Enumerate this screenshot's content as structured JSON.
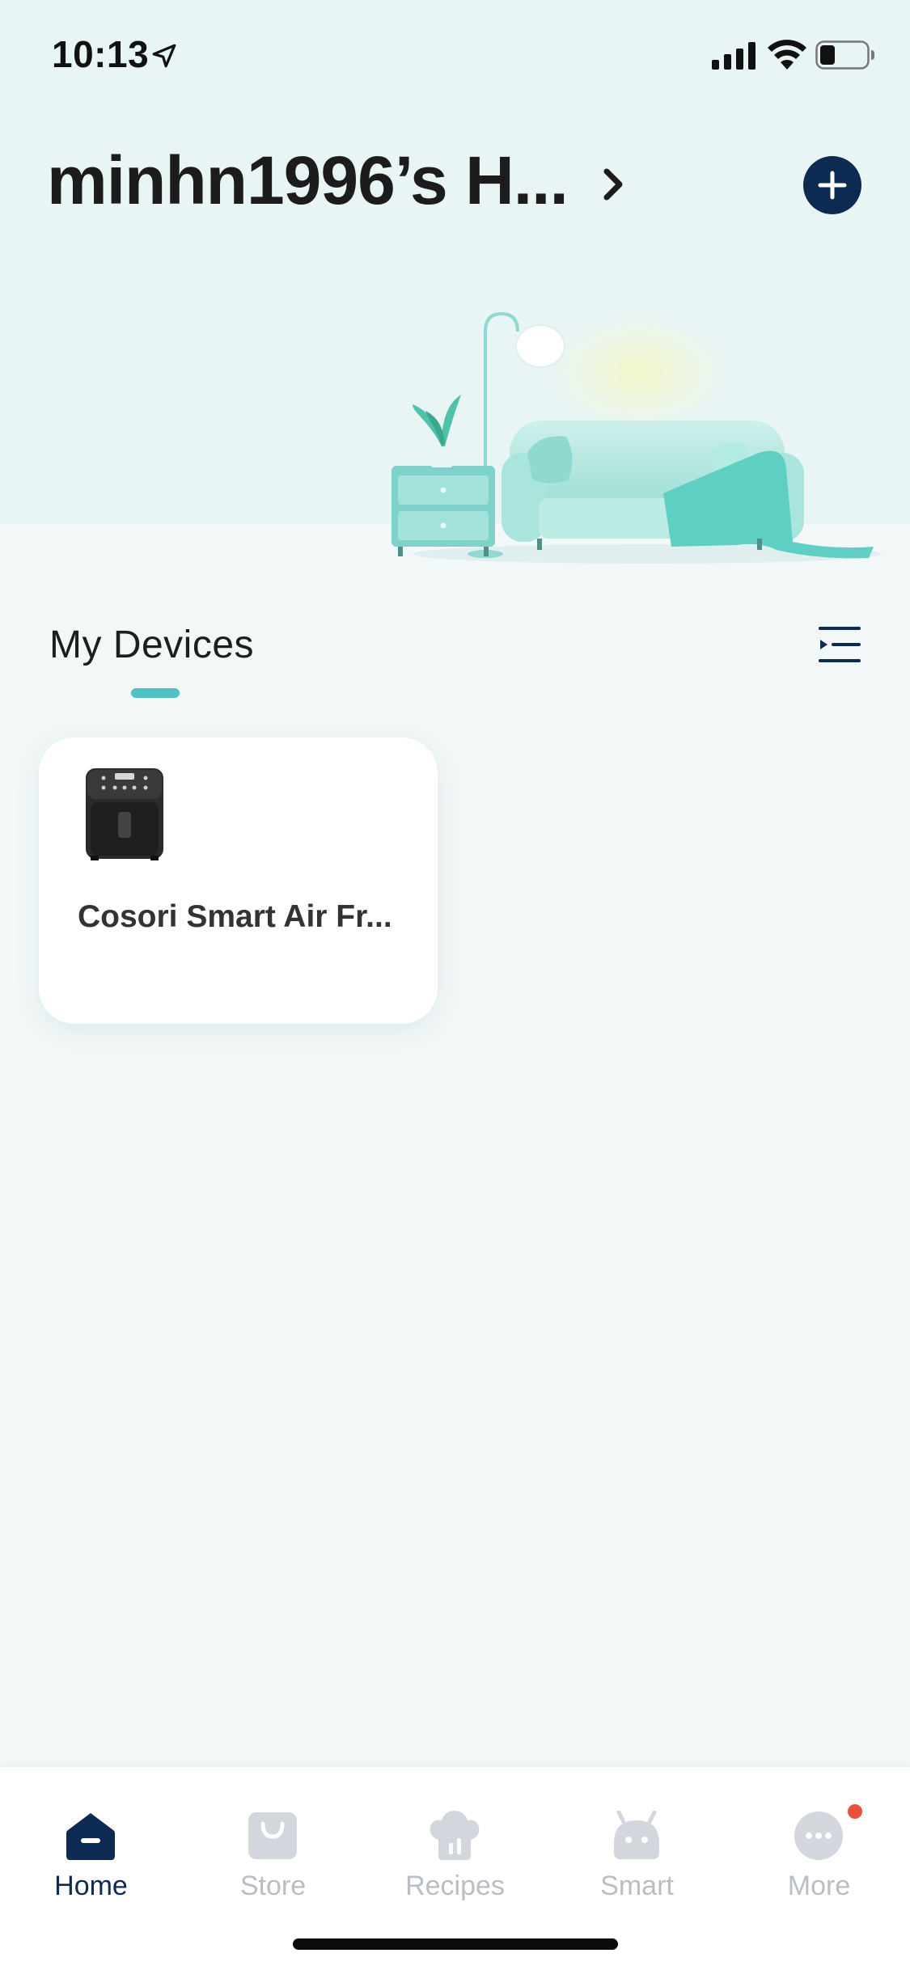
{
  "status_bar": {
    "time": "10:13",
    "icons": [
      "location-arrow-icon",
      "cellular-signal-icon",
      "wifi-icon",
      "battery-icon"
    ]
  },
  "header": {
    "title": "minhn1996’s H...",
    "chevron_icon": "chevron-right-icon",
    "add_icon": "plus-icon"
  },
  "devices": {
    "section_title": "My Devices",
    "view_toggle_icon": "list-filter-icon",
    "items": [
      {
        "name": "Cosori Smart Air Fr...",
        "image": "air-fryer-image"
      }
    ]
  },
  "tab_bar": {
    "active": "Home",
    "tabs": [
      {
        "label": "Home",
        "icon": "home-icon"
      },
      {
        "label": "Store",
        "icon": "shopping-bag-icon"
      },
      {
        "label": "Recipes",
        "icon": "chef-hat-icon"
      },
      {
        "label": "Smart",
        "icon": "robot-icon"
      },
      {
        "label": "More",
        "icon": "more-dots-icon",
        "has_notification": true
      }
    ]
  },
  "colors": {
    "primary": "#0d2a52",
    "accent": "#4fc2c4",
    "hero_background": "#e9f5f5",
    "page_background": "#f2f8f8",
    "inactive_tab": "#b9bec5",
    "notification": "#e5533d"
  }
}
